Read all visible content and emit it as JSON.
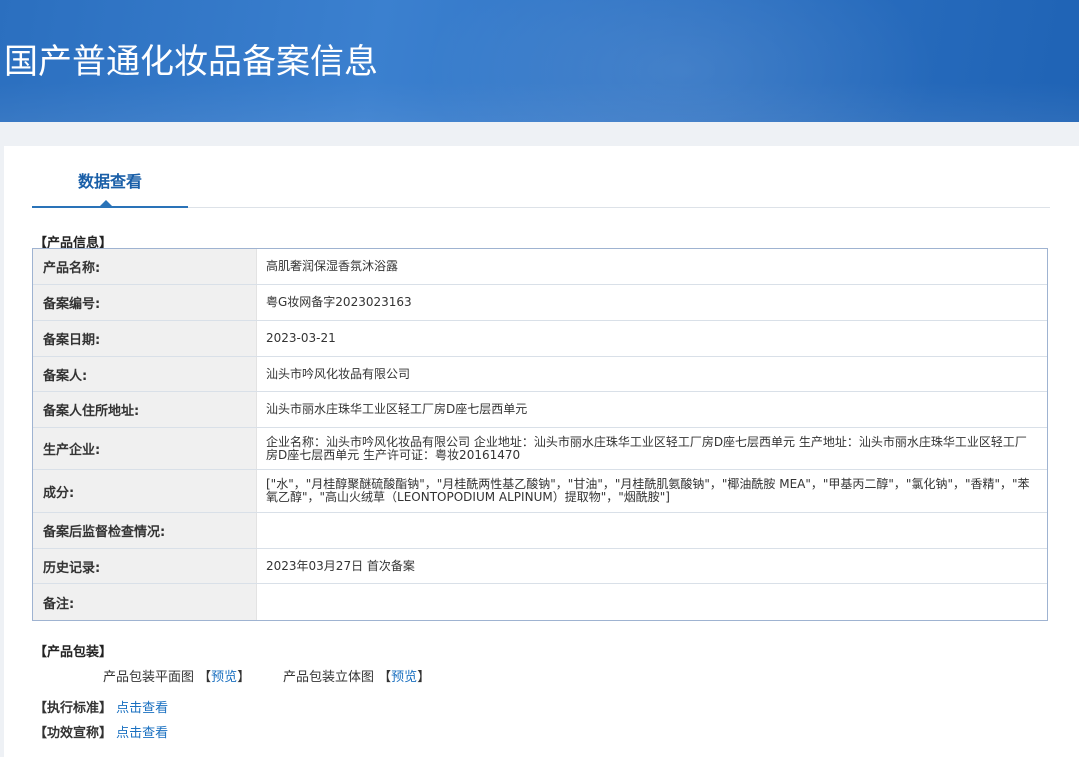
{
  "header": {
    "title": "国产普通化妆品备案信息"
  },
  "tabs": [
    {
      "label": "数据查看"
    }
  ],
  "product_info": {
    "section_label": "【产品信息】",
    "rows": [
      {
        "label": "产品名称:",
        "value": "高肌奢润保湿香氛沐浴露"
      },
      {
        "label": "备案编号:",
        "value": "粤G妆网备字2023023163"
      },
      {
        "label": "备案日期:",
        "value": "2023-03-21"
      },
      {
        "label": "备案人:",
        "value": "汕头市吟风化妆品有限公司"
      },
      {
        "label": "备案人住所地址:",
        "value": "汕头市丽水庄珠华工业区轻工厂房D座七层西单元"
      },
      {
        "label": "生产企业:",
        "value": "企业名称：汕头市吟风化妆品有限公司 企业地址：汕头市丽水庄珠华工业区轻工厂房D座七层西单元 生产地址：汕头市丽水庄珠华工业区轻工厂房D座七层西单元 生产许可证：粤妆20161470"
      },
      {
        "label": "成分:",
        "value": "[\"水\"，\"月桂醇聚醚硫酸酯钠\"，\"月桂酰两性基乙酸钠\"，\"甘油\"，\"月桂酰肌氨酸钠\"，\"椰油酰胺 MEA\"，\"甲基丙二醇\"，\"氯化钠\"，\"香精\"，\"苯氧乙醇\"，\"高山火绒草（LEONTOPODIUM ALPINUM）提取物\"，\"烟酰胺\"]"
      },
      {
        "label": "备案后监督检查情况:",
        "value": ""
      },
      {
        "label": "历史记录:",
        "value": "2023年03月27日 首次备案"
      },
      {
        "label": "备注:",
        "value": ""
      }
    ]
  },
  "packaging": {
    "section_label": "【产品包装】",
    "flat_label": "产品包装平面图",
    "flat_open": "【",
    "flat_link": "预览",
    "flat_close": "】",
    "stereo_label": "产品包装立体图",
    "stereo_open": "【",
    "stereo_link": "预览",
    "stereo_close": "】"
  },
  "standard": {
    "label": "【执行标准】",
    "link": "点击查看"
  },
  "efficacy": {
    "label": "【功效宣称】",
    "link": "点击查看"
  }
}
